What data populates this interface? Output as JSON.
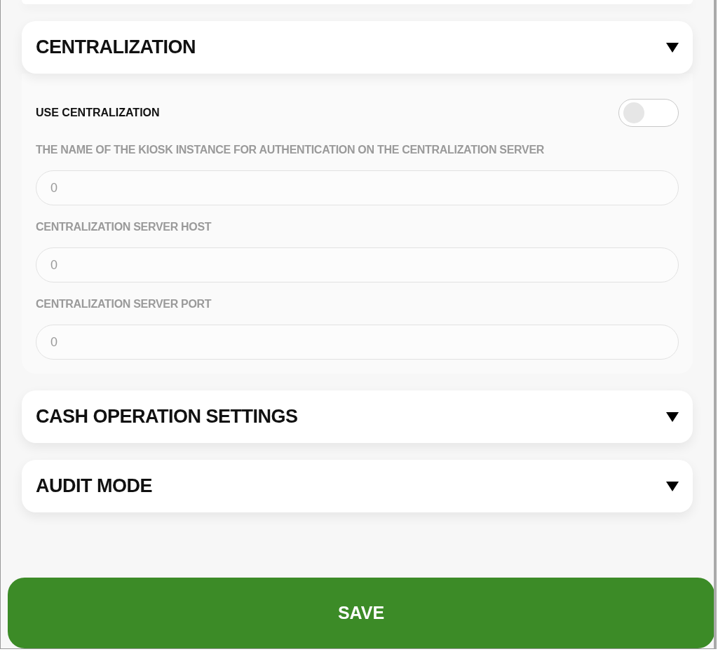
{
  "sections": [
    {
      "title": "CENTRALIZATION",
      "toggle": {
        "label": "USE CENTRALIZATION",
        "on": false
      },
      "fields": [
        {
          "label": "THE NAME OF THE KIOSK INSTANCE FOR AUTHENTICATION ON THE CENTRALIZATION SERVER",
          "value": "0",
          "disabled": true
        },
        {
          "label": "CENTRALIZATION SERVER HOST",
          "value": "0",
          "disabled": true
        },
        {
          "label": "CENTRALIZATION SERVER PORT",
          "value": "0",
          "disabled": true
        }
      ]
    },
    {
      "title": "CASH OPERATION SETTINGS"
    },
    {
      "title": "AUDIT MODE"
    }
  ],
  "save_button": "SAVE"
}
